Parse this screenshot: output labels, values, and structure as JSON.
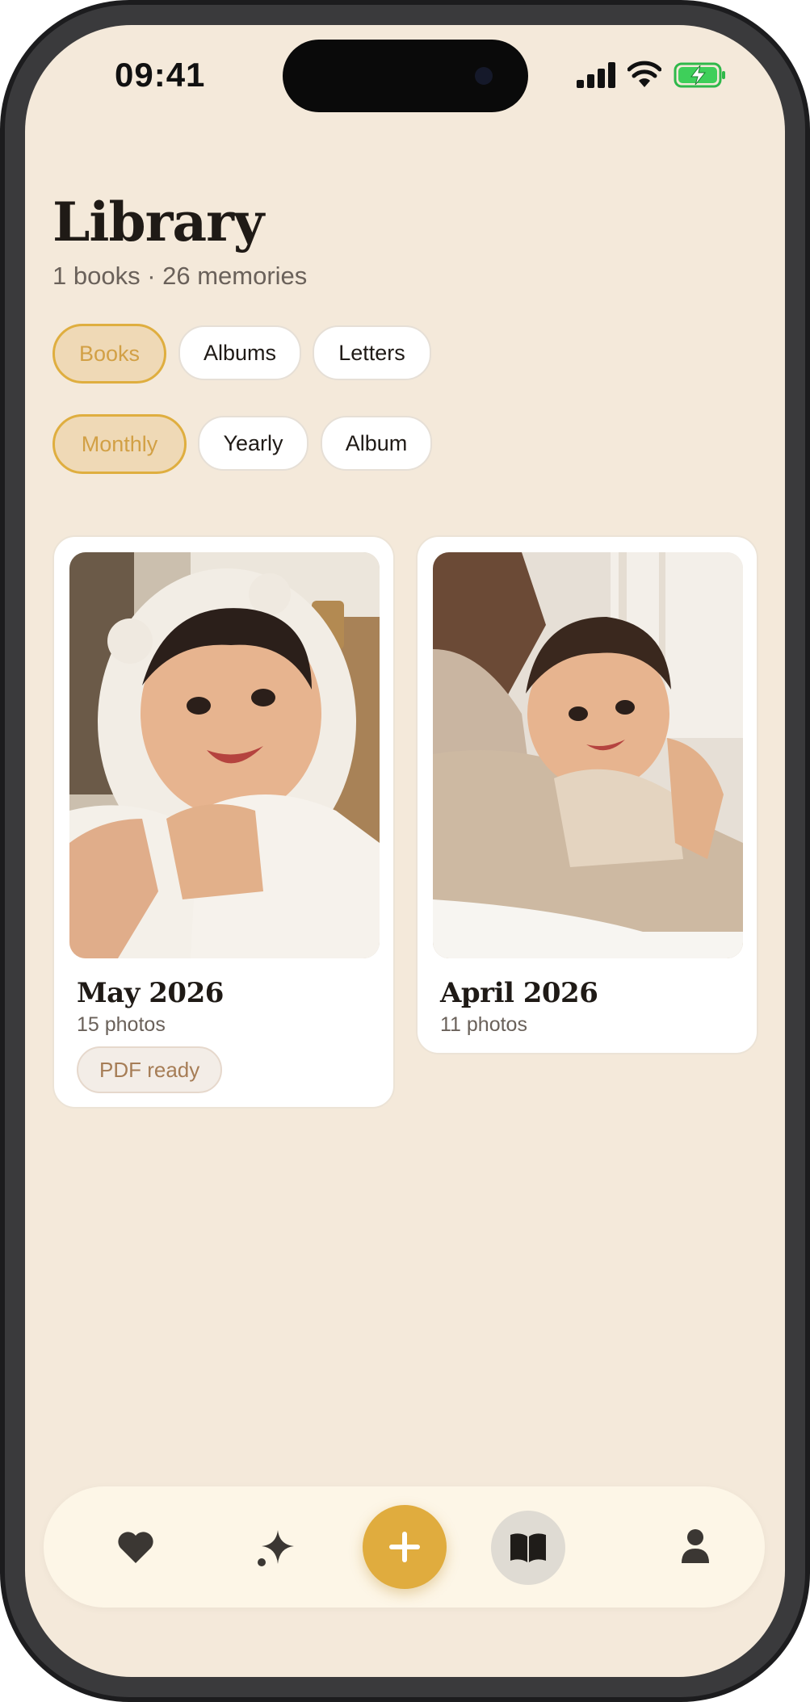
{
  "status": {
    "time": "09:41"
  },
  "header": {
    "title": "Library",
    "subtitle": "1 books · 26 memories"
  },
  "filters": {
    "type": [
      {
        "label": "Books",
        "active": true
      },
      {
        "label": "Albums",
        "active": false
      },
      {
        "label": "Letters",
        "active": false
      }
    ],
    "period": [
      {
        "label": "Monthly",
        "active": true
      },
      {
        "label": "Yearly",
        "active": false
      },
      {
        "label": "Album",
        "active": false
      }
    ]
  },
  "books": [
    {
      "title": "May 2026",
      "count": "15 photos",
      "badge": "PDF ready",
      "photo": "baby-in-bear-hooded-towel"
    },
    {
      "title": "April 2026",
      "count": "11 photos",
      "photo": "baby-on-parent-lap"
    }
  ],
  "tabbar": {
    "items": [
      {
        "icon": "heart-icon"
      },
      {
        "icon": "sparkle-icon"
      },
      {
        "icon": "plus-icon"
      },
      {
        "icon": "book-icon",
        "active": true
      },
      {
        "icon": "person-icon"
      }
    ]
  },
  "colors": {
    "background": "#f4e9da",
    "accent": "#e0ac3e",
    "card": "#ffffff"
  }
}
